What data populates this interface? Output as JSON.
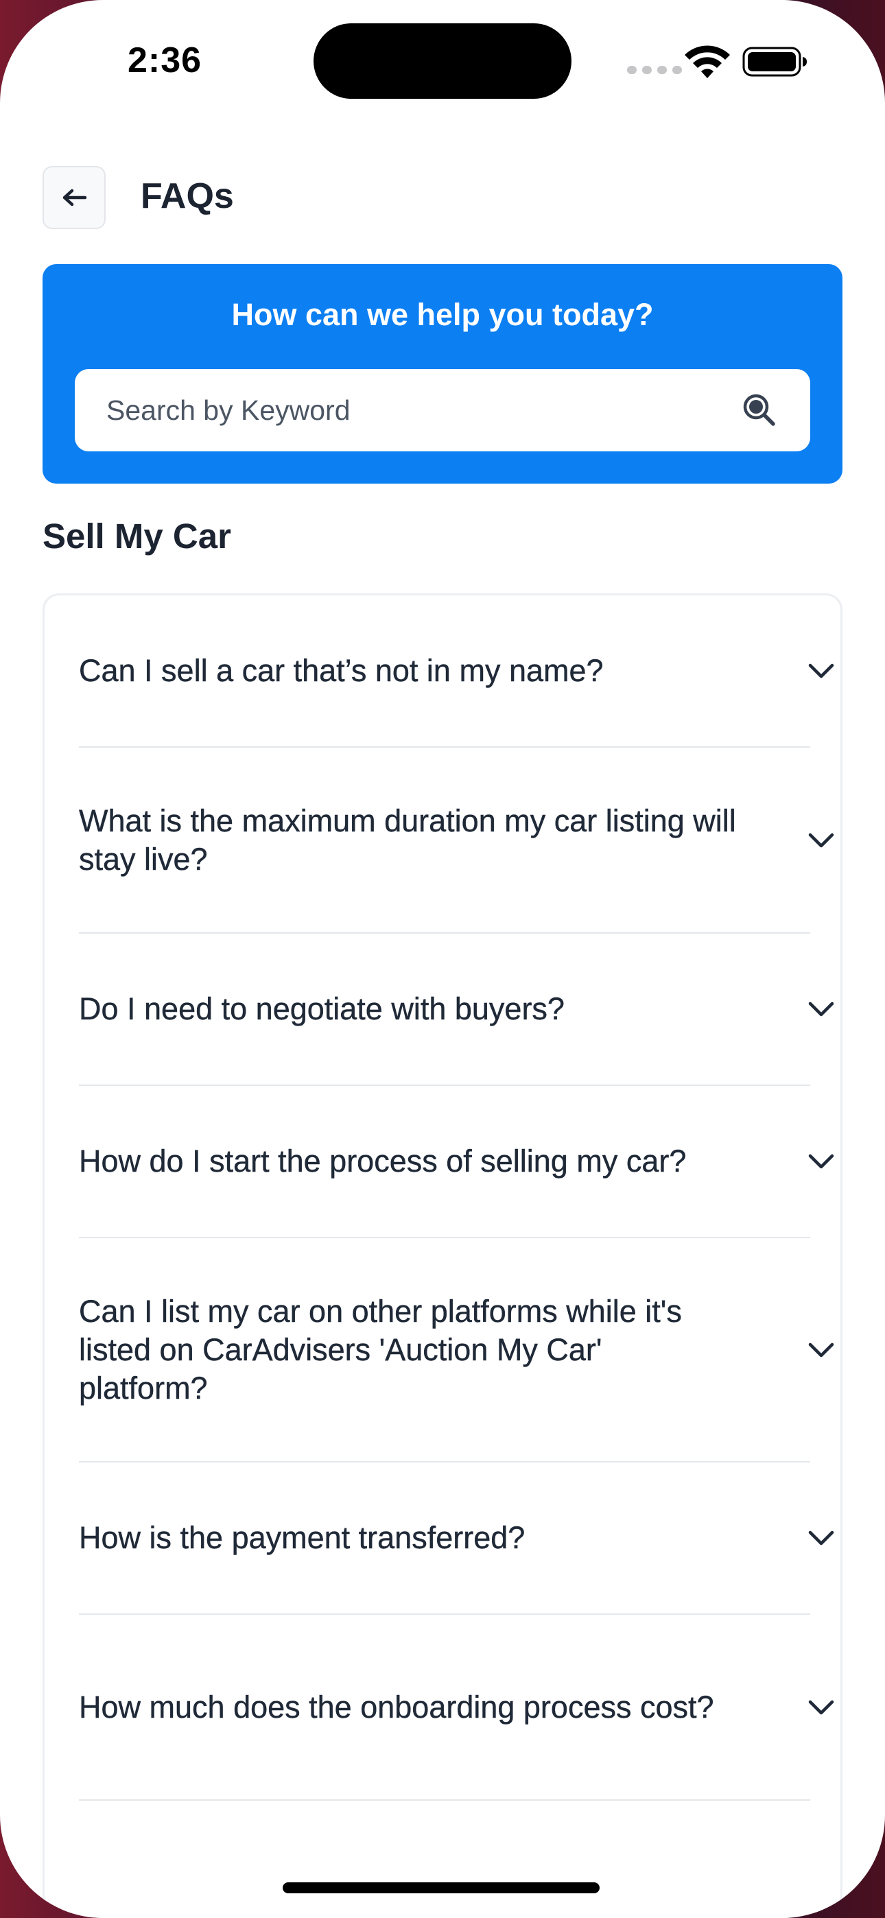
{
  "status_bar": {
    "time": "2:36"
  },
  "header": {
    "back_icon": "arrow-left-icon",
    "title": "FAQs"
  },
  "hero": {
    "title": "How can we help you today?",
    "search": {
      "placeholder": "Search by Keyword",
      "value": "",
      "icon": "search-icon"
    }
  },
  "section": {
    "title": "Sell My Car"
  },
  "faqs": [
    {
      "question": "Can I sell a car that’s not in my name?"
    },
    {
      "question": "What is the maximum duration my car listing will stay live?"
    },
    {
      "question": "Do I need to negotiate with buyers?"
    },
    {
      "question": "How do I start the process of selling my car?"
    },
    {
      "question": "Can I list my car on other platforms while it's listed on CarAdvisers 'Auction My Car' platform?"
    },
    {
      "question": "How is the payment transferred?"
    },
    {
      "question": "How much does the onboarding process cost?"
    }
  ],
  "colors": {
    "accent": "#0c7ff2",
    "text": "#1f2937",
    "divider": "#e4e7eb"
  }
}
